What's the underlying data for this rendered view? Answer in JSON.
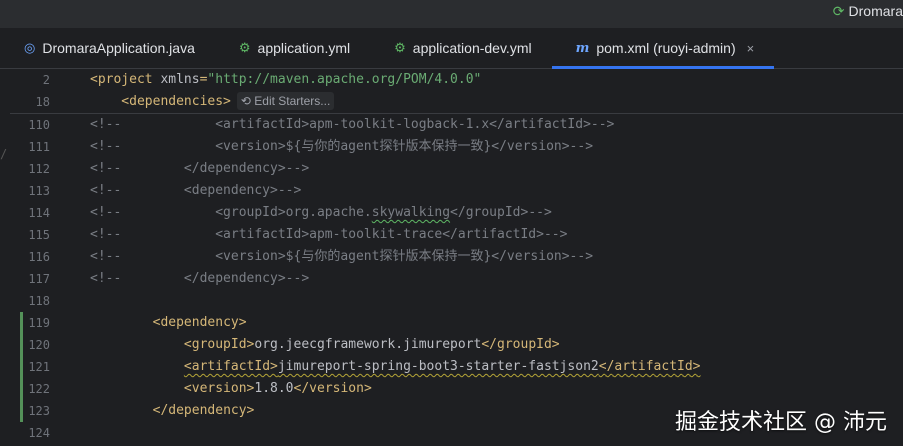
{
  "window": {
    "run_config": "Dromara"
  },
  "tabs": [
    {
      "label": "DromaraApplication.java",
      "icon": "java-class-icon"
    },
    {
      "label": "application.yml",
      "icon": "yml-icon"
    },
    {
      "label": "application-dev.yml",
      "icon": "yml-icon"
    },
    {
      "label": "pom.xml (ruoyi-admin)",
      "icon": "maven-icon",
      "active": true,
      "close": "×"
    }
  ],
  "sticky_lines": [
    {
      "num": "2",
      "parts": [
        [
          "tag",
          "<project "
        ],
        [
          "attr",
          "xmlns"
        ],
        [
          "tag",
          "="
        ],
        [
          "str",
          "\"http://maven.apache.org/POM/4.0.0\""
        ]
      ]
    },
    {
      "num": "18",
      "parts": [
        [
          "tag",
          "    <dependencies>"
        ]
      ],
      "hint": "Edit Starters..."
    }
  ],
  "lines": [
    {
      "num": "110",
      "parts": [
        [
          "cmt",
          "<!--            <artifactId>apm-toolkit-logback-1.x</artifactId>-->"
        ]
      ]
    },
    {
      "num": "111",
      "parts": [
        [
          "cmt",
          "<!--            <version>${与你的agent探针版本保持一致}</version>-->"
        ]
      ]
    },
    {
      "num": "112",
      "parts": [
        [
          "cmt",
          "<!--        </dependency>-->"
        ]
      ]
    },
    {
      "num": "113",
      "parts": [
        [
          "cmt",
          "<!--        <dependency>-->"
        ]
      ]
    },
    {
      "num": "114",
      "parts": [
        [
          "cmt",
          "<!--            <groupId>org.apache."
        ],
        [
          "cmtg",
          "skywalking"
        ],
        [
          "cmt",
          "</groupId>-->"
        ]
      ]
    },
    {
      "num": "115",
      "parts": [
        [
          "cmt",
          "<!--            <artifactId>apm-toolkit-trace</artifactId>-->"
        ]
      ]
    },
    {
      "num": "116",
      "parts": [
        [
          "cmt",
          "<!--            <version>${与你的agent探针版本保持一致}</version>-->"
        ]
      ]
    },
    {
      "num": "117",
      "parts": [
        [
          "cmt",
          "<!--        </dependency>-->"
        ]
      ]
    },
    {
      "num": "118",
      "parts": []
    },
    {
      "num": "119",
      "parts": [
        [
          "pad",
          "        "
        ],
        [
          "tag",
          "<dependency>"
        ]
      ],
      "changed": true
    },
    {
      "num": "120",
      "parts": [
        [
          "pad",
          "            "
        ],
        [
          "tag",
          "<groupId>"
        ],
        [
          "attr",
          "org.jeecgframework.jimureport"
        ],
        [
          "tag",
          "</groupId>"
        ]
      ],
      "changed": true
    },
    {
      "num": "121",
      "parts": [
        [
          "pad",
          "            "
        ],
        [
          "tag",
          "<artifactId>"
        ],
        [
          "attr",
          "jimureport-spring-boot3-starter-fastjson2"
        ],
        [
          "tag",
          "</artifactId>"
        ]
      ],
      "changed": true,
      "warn": true
    },
    {
      "num": "122",
      "parts": [
        [
          "pad",
          "            "
        ],
        [
          "tag",
          "<version>"
        ],
        [
          "attr",
          "1.8.0"
        ],
        [
          "tag",
          "</version>"
        ]
      ],
      "changed": true
    },
    {
      "num": "123",
      "parts": [
        [
          "pad",
          "        "
        ],
        [
          "tag",
          "</dependency>"
        ]
      ],
      "changed": true
    },
    {
      "num": "124",
      "parts": []
    }
  ],
  "watermark": "掘金技术社区 @ 沛元"
}
